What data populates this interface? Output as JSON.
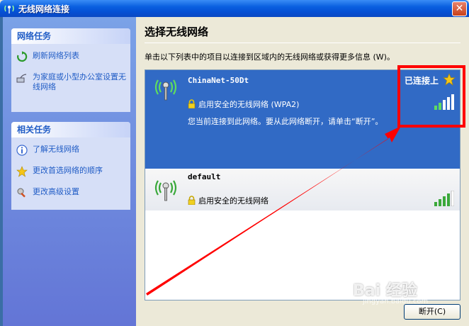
{
  "window": {
    "title": "无线网络连接",
    "close_label": "✕"
  },
  "taskpane": {
    "network_tasks": {
      "header": "网络任务",
      "items": [
        {
          "label": "刷新网络列表",
          "icon": "refresh-icon"
        },
        {
          "label": "为家庭或小型办公室设置无线网络",
          "icon": "setup-network-icon"
        }
      ]
    },
    "related_tasks": {
      "header": "相关任务",
      "items": [
        {
          "label": "了解无线网络",
          "icon": "info-icon"
        },
        {
          "label": "更改首选网络的顺序",
          "icon": "star-icon"
        },
        {
          "label": "更改高级设置",
          "icon": "settings-icon"
        }
      ]
    }
  },
  "main": {
    "title": "选择无线网络",
    "description": "单击以下列表中的项目以连接到区域内的无线网络或获得更多信息 (W)。",
    "networks": [
      {
        "ssid": "ChinaNet-50Dt",
        "security": "启用安全的无线网络 (WPA2)",
        "status": "已连接上",
        "connected_note": "您当前连接到此网络。要从此网络断开，请单击“断开”。",
        "signal_bars": 4,
        "selected": true
      },
      {
        "ssid": "default",
        "security": "启用安全的无线网络",
        "signal_bars": 4,
        "selected": false
      }
    ],
    "disconnect_label": "断开(C)"
  },
  "watermark": {
    "text": "Bai 经验",
    "sub": "jingyan.baidu.com"
  },
  "colors": {
    "selection": "#316ac5",
    "annotation": "#ff0000",
    "link": "#215dc6"
  }
}
